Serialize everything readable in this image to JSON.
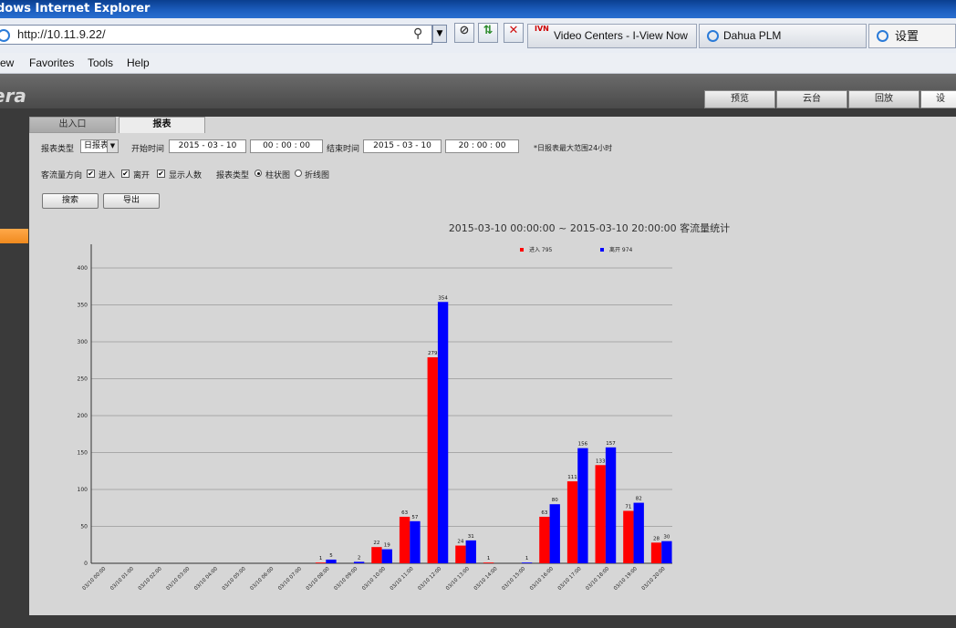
{
  "window": {
    "title": "dows Internet Explorer"
  },
  "address": {
    "url": "http://10.11.9.22/"
  },
  "browser_tabs": [
    {
      "label": "Video Centers - I-View Now",
      "icon": "ivn-logo"
    },
    {
      "label": "Dahua PLM",
      "icon": "ie-icon"
    },
    {
      "label": "设置",
      "icon": "ie-icon"
    }
  ],
  "menu": {
    "items": [
      "ew",
      "Favorites",
      "Tools",
      "Help"
    ]
  },
  "app": {
    "brand": "era",
    "top_tabs": [
      "预览",
      "云台",
      "回放",
      "设"
    ]
  },
  "subtabs": [
    "出入口",
    "报表"
  ],
  "form": {
    "report_type_label": "报表类型",
    "report_type_value": "日报表",
    "start_label": "开始时间",
    "start_date": "2015 - 03 - 10",
    "start_time": "00 : 00 : 00",
    "end_label": "结束时间",
    "end_date": "2015 - 03 - 10",
    "end_time": "20 : 00 : 00",
    "note": "*日报表最大范围24小时",
    "direction_label": "客流量方向",
    "cb_in": "进入",
    "cb_out": "离开",
    "cb_show": "显示人数",
    "chart_type_label": "报表类型",
    "radio_bar": "柱状图",
    "radio_line": "折线图",
    "search_btn": "搜索",
    "export_btn": "导出"
  },
  "chart_data": {
    "type": "bar",
    "title": "2015-03-10 00:00:00 ~ 2015-03-10 20:00:00 客流量统计",
    "categories": [
      "03/10 00:00",
      "03/10 01:00",
      "03/10 02:00",
      "03/10 03:00",
      "03/10 04:00",
      "03/10 05:00",
      "03/10 06:00",
      "03/10 07:00",
      "03/10 08:00",
      "03/10 09:00",
      "03/10 10:00",
      "03/10 11:00",
      "03/10 12:00",
      "03/10 13:00",
      "03/10 14:00",
      "03/10 15:00",
      "03/10 16:00",
      "03/10 17:00",
      "03/10 18:00",
      "03/10 19:00",
      "03/10 20:00"
    ],
    "series": [
      {
        "name": "进入",
        "total": "795",
        "color": "#ff0000",
        "values": [
          0,
          0,
          0,
          0,
          0,
          0,
          0,
          0,
          1,
          0,
          22,
          63,
          279,
          24,
          1,
          0,
          63,
          111,
          133,
          71,
          28
        ]
      },
      {
        "name": "离开",
        "total": "974",
        "color": "#0000ff",
        "values": [
          0,
          0,
          0,
          0,
          0,
          0,
          0,
          0,
          5,
          2,
          19,
          57,
          354,
          31,
          0,
          1,
          80,
          156,
          157,
          82,
          30
        ]
      }
    ],
    "labels": [
      [
        "",
        "",
        "",
        "",
        "",
        "",
        "",
        "",
        "1",
        "",
        "22",
        "63",
        "279",
        "24",
        "1",
        "",
        "63",
        "111",
        "133",
        "71",
        "28"
      ],
      [
        "",
        "",
        "",
        "",
        "",
        "",
        "",
        "",
        "5",
        "2",
        "19",
        "57",
        "354",
        "31",
        "",
        "1",
        "80",
        "156",
        "157",
        "82",
        "30"
      ]
    ],
    "ylim": [
      0,
      400
    ],
    "yticks": [
      0,
      50,
      100,
      150,
      200,
      250,
      300,
      350,
      400
    ],
    "grid": true,
    "legend": "top-right"
  }
}
